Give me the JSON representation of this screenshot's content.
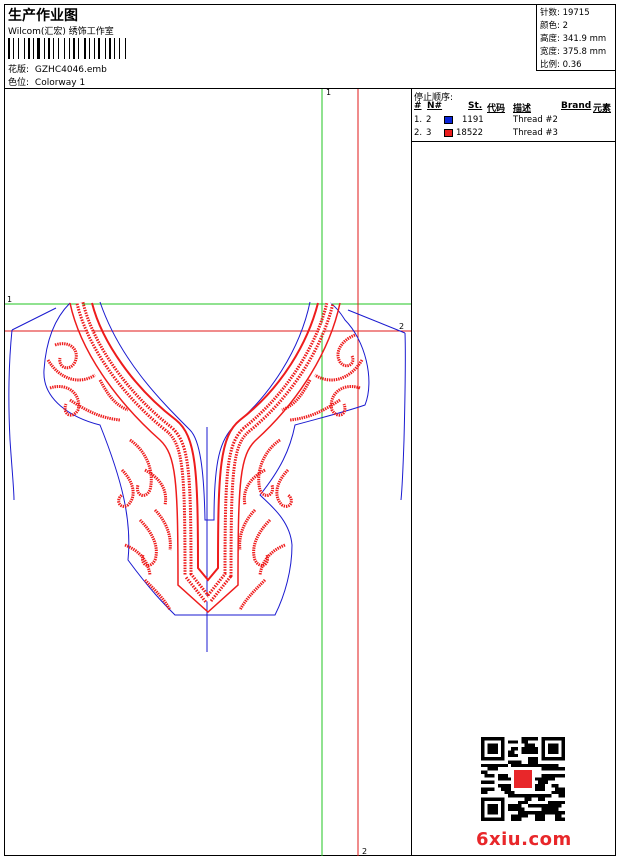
{
  "header": {
    "title": "生产作业图",
    "company": "Wilcom(汇宏) 绣饰工作室",
    "design_label": "花版:",
    "design_value": "GZHC4046.emb",
    "colorway_label": "色位:",
    "colorway_value": "Colorway 1"
  },
  "stats": {
    "stitches_label": "针数:",
    "stitches_value": "19715",
    "colors_label": "颜色:",
    "colors_value": "2",
    "height_label": "高度:",
    "height_value": "341.9 mm",
    "width_label": "宽度:",
    "width_value": "375.8 mm",
    "ratio_label": "比例:",
    "ratio_value": "0.36"
  },
  "stop_sequence": {
    "title": "停止顺序:",
    "headers": {
      "num": "#",
      "needle": "N#",
      "st": "St.",
      "code": "代码",
      "desc": "描述",
      "brand": "Brand",
      "element": "元素"
    },
    "rows": [
      {
        "num": "1.",
        "needle": "2",
        "color": "#0a24d8",
        "code": "1191",
        "desc": "Thread #2"
      },
      {
        "num": "2.",
        "needle": "3",
        "color": "#ea1c1c",
        "code": "18522",
        "desc": "Thread #3"
      }
    ]
  },
  "guides": {
    "v1": "1",
    "v2": "2",
    "h1": "1",
    "h2": "2"
  },
  "colors": {
    "green_guide": "#22c422",
    "red_guide": "#e01a1a",
    "outline": "#1a1ad0",
    "embroidery": "#ee1c1c",
    "watermark": "#e8272a"
  },
  "watermark": "6xiu.com"
}
